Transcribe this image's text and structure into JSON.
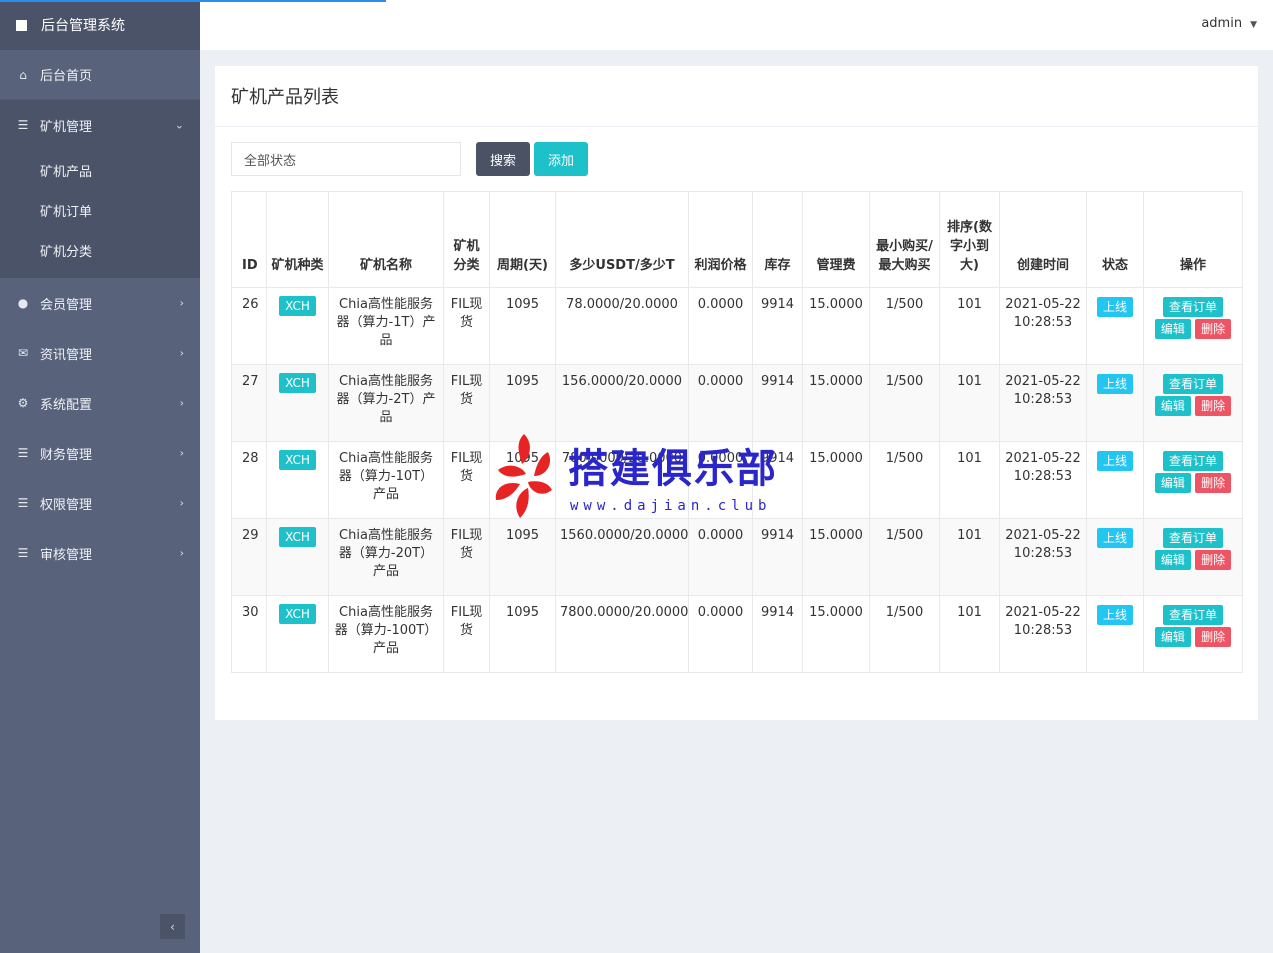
{
  "app": {
    "title": "后台管理系统"
  },
  "topbar": {
    "user": "admin"
  },
  "sidebar": {
    "home": "后台首页",
    "miner": {
      "label": "矿机管理",
      "children": [
        "矿机产品",
        "矿机订单",
        "矿机分类"
      ]
    },
    "items": [
      "会员管理",
      "资讯管理",
      "系统配置",
      "财务管理",
      "权限管理",
      "审核管理"
    ]
  },
  "panel": {
    "title": "矿机产品列表",
    "filter_value": "全部状态",
    "search_label": "搜索",
    "add_label": "添加"
  },
  "table": {
    "headers": [
      "ID",
      "矿机种类",
      "矿机名称",
      "矿机分类",
      "周期(天)",
      "多少USDT/多少T",
      "利润价格",
      "库存",
      "管理费",
      "最小购买/最大购买",
      "排序(数字小到大)",
      "创建时间",
      "状态",
      "操作"
    ],
    "actions": {
      "view": "查看订单",
      "edit": "编辑",
      "delete": "删除"
    },
    "rows": [
      {
        "id": "26",
        "kind": "XCH",
        "name": "Chia高性能服务器（算力-1T）产品",
        "category": "FIL现货",
        "period": "1095",
        "price": "78.0000/20.0000",
        "profit": "0.0000",
        "stock": "9914",
        "fee": "15.0000",
        "buy_range": "1/500",
        "sort": "101",
        "created": "2021-05-22 10:28:53",
        "status": "上线"
      },
      {
        "id": "27",
        "kind": "XCH",
        "name": "Chia高性能服务器（算力-2T）产品",
        "category": "FIL现货",
        "period": "1095",
        "price": "156.0000/20.0000",
        "profit": "0.0000",
        "stock": "9914",
        "fee": "15.0000",
        "buy_range": "1/500",
        "sort": "101",
        "created": "2021-05-22 10:28:53",
        "status": "上线"
      },
      {
        "id": "28",
        "kind": "XCH",
        "name": "Chia高性能服务器（算力-10T）产品",
        "category": "FIL现货",
        "period": "1095",
        "price": "780.0000/20.0000",
        "profit": "0.0000",
        "stock": "9914",
        "fee": "15.0000",
        "buy_range": "1/500",
        "sort": "101",
        "created": "2021-05-22 10:28:53",
        "status": "上线"
      },
      {
        "id": "29",
        "kind": "XCH",
        "name": "Chia高性能服务器（算力-20T）产品",
        "category": "FIL现货",
        "period": "1095",
        "price": "1560.0000/20.0000",
        "profit": "0.0000",
        "stock": "9914",
        "fee": "15.0000",
        "buy_range": "1/500",
        "sort": "101",
        "created": "2021-05-22 10:28:53",
        "status": "上线"
      },
      {
        "id": "30",
        "kind": "XCH",
        "name": "Chia高性能服务器（算力-100T）产品",
        "category": "FIL现货",
        "period": "1095",
        "price": "7800.0000/20.0000",
        "profit": "0.0000",
        "stock": "9914",
        "fee": "15.0000",
        "buy_range": "1/500",
        "sort": "101",
        "created": "2021-05-22 10:28:53",
        "status": "上线"
      }
    ]
  },
  "watermark": {
    "text": "搭建俱乐部",
    "url": "www.dajian.club"
  },
  "colors": {
    "sidebar": "#58627a",
    "sidebar_dark": "#4b5368",
    "teal": "#1ec1c9",
    "red": "#ed5565",
    "status": "#23c6f0"
  }
}
